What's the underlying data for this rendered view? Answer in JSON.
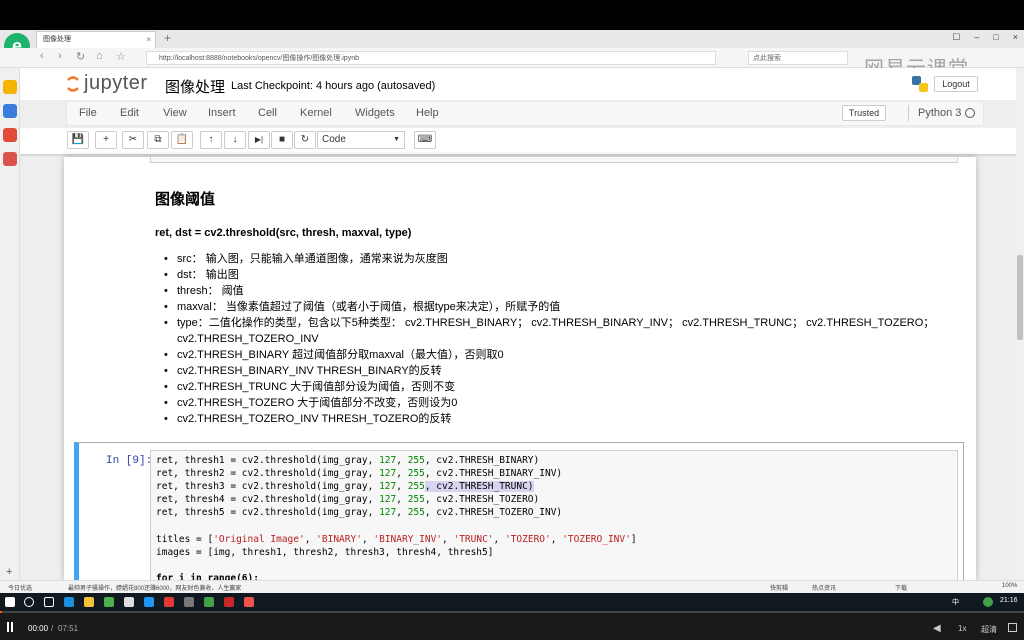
{
  "browser": {
    "tab_title": "图像处理",
    "tab_close": "×",
    "new_tab": "+",
    "url": "http://localhost:8888/notebooks/opencv/图像操作/图像处理.ipynb",
    "search_placeholder": "点此搜索",
    "watermark": "网易云课堂",
    "window_controls": [
      "☐",
      "–",
      "□",
      "×"
    ]
  },
  "jupyter": {
    "logo_text": "jupyter",
    "notebook_title": "图像处理",
    "checkpoint": "Last Checkpoint: 4 hours ago (autosaved)",
    "logout": "Logout",
    "menu": [
      "File",
      "Edit",
      "View",
      "Insert",
      "Cell",
      "Kernel",
      "Widgets",
      "Help"
    ],
    "trusted": "Trusted",
    "kernel": "Python 3",
    "cell_type": "Code",
    "toolbar_glyphs": {
      "save": "💾",
      "add": "+",
      "cut": "✂",
      "copy": "⧉",
      "paste": "📋",
      "up": "↑",
      "down": "↓",
      "run": "▶|",
      "stop": "■",
      "restart": "↻",
      "keyboard": "⌨"
    }
  },
  "markdown": {
    "heading": "图像阈值",
    "signature": "ret, dst = cv2.threshold(src, thresh, maxval, type)",
    "items": [
      "src： 输入图，只能输入单通道图像，通常来说为灰度图",
      "dst： 输出图",
      "thresh： 阈值",
      "maxval： 当像素值超过了阈值（或者小于阈值，根据type来决定），所赋予的值",
      "type：二值化操作的类型，包含以下5种类型： cv2.THRESH_BINARY； cv2.THRESH_BINARY_INV； cv2.THRESH_TRUNC； cv2.THRESH_TOZERO； cv2.THRESH_TOZERO_INV",
      "cv2.THRESH_BINARY 超过阈值部分取maxval（最大值），否则取0",
      "cv2.THRESH_BINARY_INV THRESH_BINARY的反转",
      "cv2.THRESH_TRUNC 大于阈值部分设为阈值，否则不变",
      "cv2.THRESH_TOZERO 大于阈值部分不改变，否则设为0",
      "cv2.THRESH_TOZERO_INV THRESH_TOZERO的反转"
    ]
  },
  "code_cell": {
    "prompt": "In [9]:",
    "lines": [
      {
        "pre": "ret, thresh1 = cv2.threshold(img_gray, ",
        "n1": "127",
        "mid": ", ",
        "n2": "255",
        "post": ", cv2.THRESH_BINARY)"
      },
      {
        "pre": "ret, thresh2 = cv2.threshold(img_gray, ",
        "n1": "127",
        "mid": ", ",
        "n2": "255",
        "post": ", cv2.THRESH_BINARY_INV)"
      },
      {
        "pre": "ret, thresh3 = cv2.threshold(img_gray, ",
        "n1": "127",
        "mid": ", ",
        "n2": "255",
        "post": ", cv2.THRESH_TRUNC)"
      },
      {
        "pre": "ret, thresh4 = cv2.threshold(img_gray, ",
        "n1": "127",
        "mid": ", ",
        "n2": "255",
        "post": ", cv2.THRESH_TOZERO)"
      },
      {
        "pre": "ret, thresh5 = cv2.threshold(img_gray, ",
        "n1": "127",
        "mid": ", ",
        "n2": "255",
        "post": ", cv2.THRESH_TOZERO_INV)"
      }
    ],
    "titles_line_pre": "titles = [",
    "titles": [
      "'Original Image'",
      "'BINARY'",
      "'BINARY_INV'",
      "'TRUNC'",
      "'TOZERO'",
      "'TOZERO_INV'"
    ],
    "titles_line_post": "]",
    "images_line": "images = [img, thresh1, thresh2, thresh3, thresh4, thresh5]",
    "partial_line": "for i in range(6):"
  },
  "status_bar": {
    "left": "今日优选",
    "news": "最帅男子骚操作，嫖娼花800还赚6000，网友财色兼收，人生赢家",
    "right": [
      "快剪辑",
      "热点资讯",
      "下载",
      "100%"
    ]
  },
  "taskbar": {
    "clock": "21:16",
    "lang": "中"
  },
  "player": {
    "current_time": "00:00",
    "separator": "/",
    "total_time": "07:51",
    "progress_fraction": 0.0,
    "speed": "1x",
    "quality": "超清"
  },
  "colors": {
    "accent_cell": "#42a5f5",
    "jupyter_orange": "#f37626",
    "browser_green": "#1db36b",
    "progress": "#ff5b00"
  }
}
